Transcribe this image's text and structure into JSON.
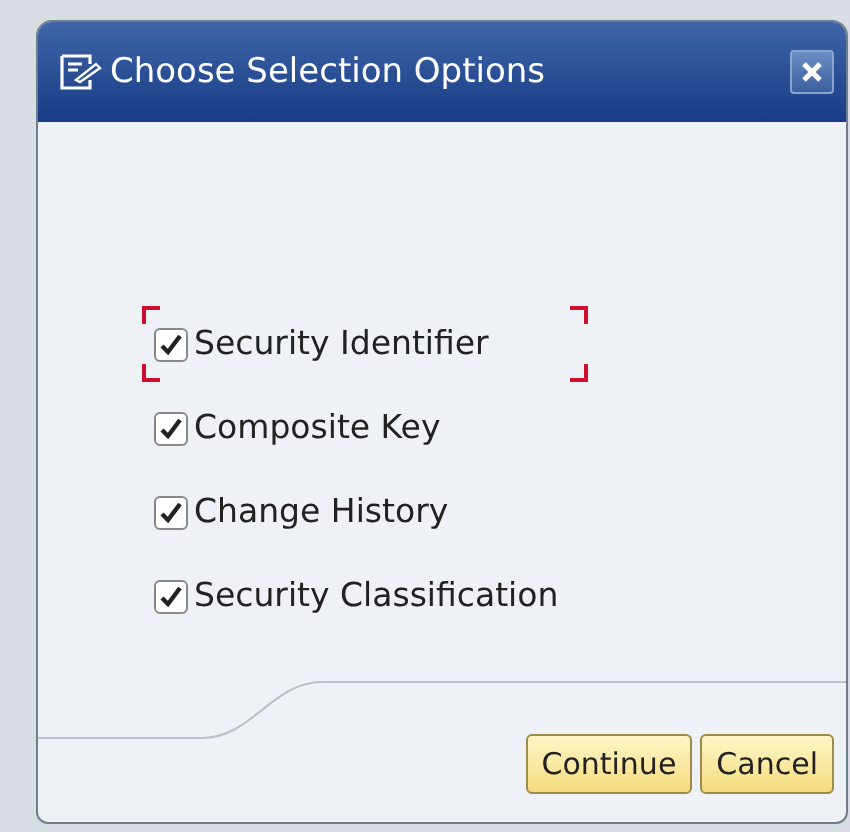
{
  "dialog": {
    "title": "Choose Selection Options"
  },
  "options": [
    {
      "label": "Security Identifier",
      "checked": true,
      "focused": true
    },
    {
      "label": "Composite Key",
      "checked": true,
      "focused": false
    },
    {
      "label": "Change History",
      "checked": true,
      "focused": false
    },
    {
      "label": "Security Classification",
      "checked": true,
      "focused": false
    }
  ],
  "buttons": [
    {
      "label": "Continue"
    },
    {
      "label": "Cancel"
    }
  ]
}
